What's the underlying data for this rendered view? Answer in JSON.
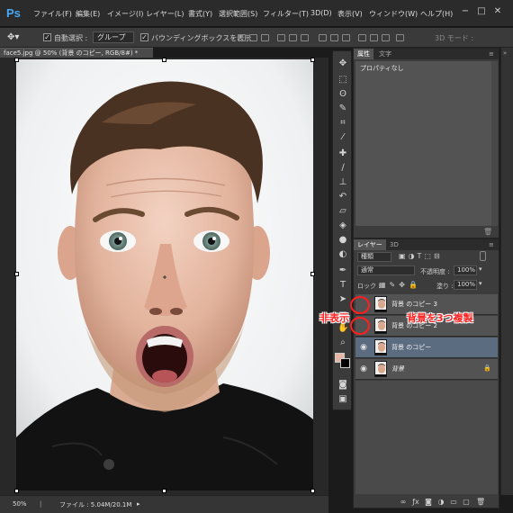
{
  "app": {
    "logo": "Ps"
  },
  "menu": [
    "ファイル(F)",
    "編集(E)",
    "イメージ(I)",
    "レイヤー(L)",
    "書式(Y)",
    "選択範囲(S)",
    "フィルター(T)",
    "3D(D)",
    "表示(V)",
    "ウィンドウ(W)",
    "ヘルプ(H)"
  ],
  "window_controls": [
    "−",
    "□",
    "✕"
  ],
  "options": {
    "auto_select_label": "自動選択 :",
    "auto_select_value": "グループ",
    "bounding_box_label": "バウンディングボックスを表示",
    "mode_3d_label": "3D モード :"
  },
  "document": {
    "tab_title": "face5.jpg @ 50% (背景 のコピー, RGB/8#) *",
    "zoom": "50%",
    "file_info": "ファイル : 5.04M/20.1M"
  },
  "properties": {
    "tabs": [
      "属性",
      "文字"
    ],
    "content": "プロパティなし"
  },
  "layers": {
    "tabs": [
      "レイヤー",
      "3D"
    ],
    "kind_filter": "種類",
    "blend_mode": "通常",
    "opacity_label": "不透明度 :",
    "opacity": "100%",
    "lock_label": "ロック :",
    "fill_label": "塗り :",
    "fill": "100%",
    "items": [
      {
        "name": "背景 のコピー 3",
        "visible": false,
        "selected": false
      },
      {
        "name": "背景 のコピー 2",
        "visible": false,
        "selected": false
      },
      {
        "name": "背景 のコピー",
        "visible": true,
        "selected": true
      },
      {
        "name": "背景",
        "visible": true,
        "selected": false,
        "locked": true
      }
    ]
  },
  "annotations": {
    "hidden_label": "非表示",
    "duplicate_label": "背景を3つ複製"
  },
  "colors": {
    "foreground": "#e8b5a5",
    "background": "#000000",
    "annotation": "#ff1e1e",
    "selected_layer": "#5c6c80"
  }
}
